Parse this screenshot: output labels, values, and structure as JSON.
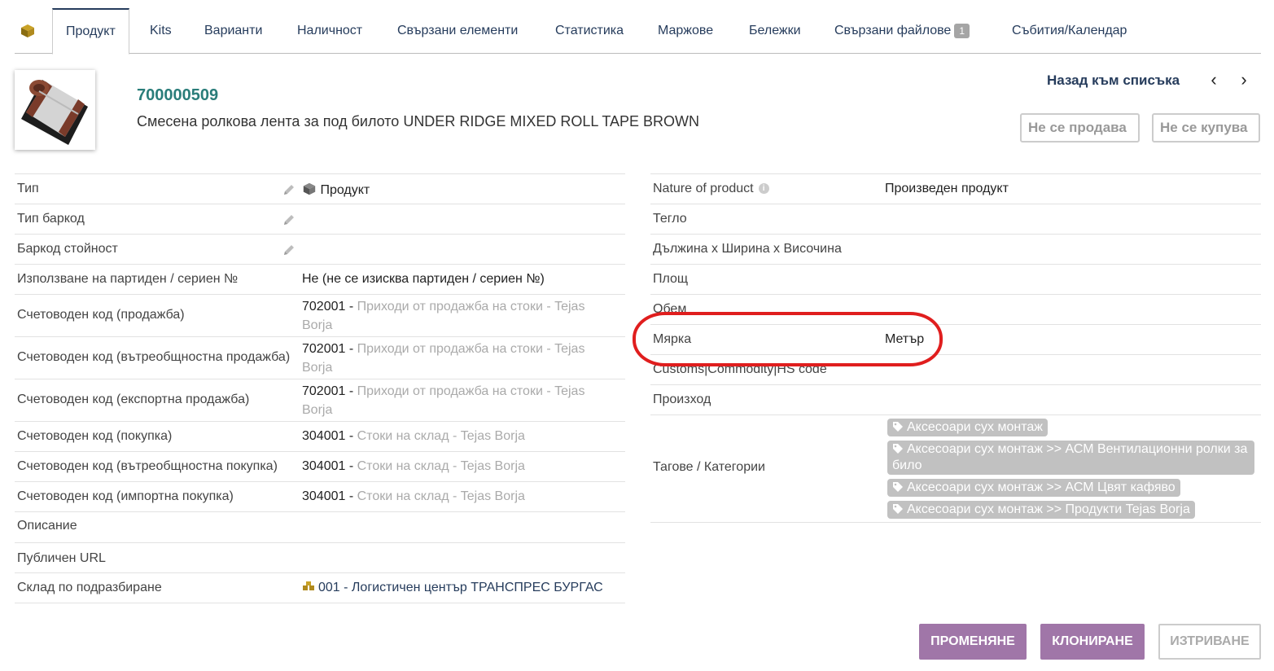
{
  "tabs": [
    {
      "label": "Продукт",
      "active": true
    },
    {
      "label": "Kits"
    },
    {
      "label": "Варианти"
    },
    {
      "label": "Наличност"
    },
    {
      "label": "Свързани елементи"
    },
    {
      "label": "Статистика"
    },
    {
      "label": "Маржове"
    },
    {
      "label": "Бележки"
    },
    {
      "label": "Свързани файлове",
      "badge": "1"
    },
    {
      "label": "Събития/Календар"
    }
  ],
  "product": {
    "ref": "700000509",
    "label": "Смесена ролкова лента за под билото UNDER RIDGE MIXED ROLL TAPE BROWN",
    "back_link": "Назад към списъка",
    "status_sell": "Не се продава",
    "status_buy": "Не се купува"
  },
  "left": {
    "type_label": "Тип",
    "type_value": "Продукт",
    "barcode_type_label": "Тип баркод",
    "barcode_value_label": "Баркод стойност",
    "lot_label": "Използване на партиден / сериен №",
    "lot_value": "Не (не се изисква партиден / сериен №)",
    "acc_sell_label": "Счетоводен код (продажба)",
    "acc_sell_code": "702001",
    "acc_sell_desc": "Приходи от продажба на стоки - Tejas Borja",
    "acc_sell_intra_label": "Счетоводен код (вътреобщностна продажба)",
    "acc_sell_intra_code": "702001",
    "acc_sell_intra_desc": "Приходи от продажба на стоки - Tejas Borja",
    "acc_sell_export_label": "Счетоводен код (експортна продажба)",
    "acc_sell_export_code": "702001",
    "acc_sell_export_desc": "Приходи от продажба на стоки - Tejas Borja",
    "acc_buy_label": "Счетоводен код (покупка)",
    "acc_buy_code": "304001",
    "acc_buy_desc": "Стоки на склад - Tejas Borja",
    "acc_buy_intra_label": "Счетоводен код (вътреобщностна покупка)",
    "acc_buy_intra_code": "304001",
    "acc_buy_intra_desc": "Стоки на склад - Tejas Borja",
    "acc_buy_import_label": "Счетоводен код (импортна покупка)",
    "acc_buy_import_code": "304001",
    "acc_buy_import_desc": "Стоки на склад - Tejas Borja",
    "description_label": "Описание",
    "public_url_label": "Публичен URL",
    "warehouse_label": "Склад по подразбиране",
    "warehouse_value": "001 - Логистичен център ТРАНСПРЕС БУРГАС"
  },
  "right": {
    "nature_label": "Nature of product",
    "nature_value": "Произведен продукт",
    "weight_label": "Тегло",
    "dimensions_label": "Дължина x Ширина x Височина",
    "area_label": "Площ",
    "volume_label": "Обем",
    "unit_label": "Мярка",
    "unit_value": "Метър",
    "customs_label": "Customs|Commodity|HS code",
    "origin_label": "Произход",
    "tags_label": "Тагове / Категории",
    "tags": [
      "Аксесоари сух монтаж",
      "Аксесоари сух монтаж >> АСМ Вентилационни ролки за било",
      "Аксесоари сух монтаж >> АСМ Цвят кафяво",
      "Аксесоари сух монтаж >> Продукти Tejas Borja"
    ]
  },
  "actions": {
    "modify": "ПРОМЕНЯНЕ",
    "clone": "КЛОНИРАНЕ",
    "delete": "ИЗТРИВАНЕ"
  },
  "colors": {
    "accent": "#a076a8",
    "ref": "#2a7d7a",
    "highlight": "#e01e1e"
  }
}
